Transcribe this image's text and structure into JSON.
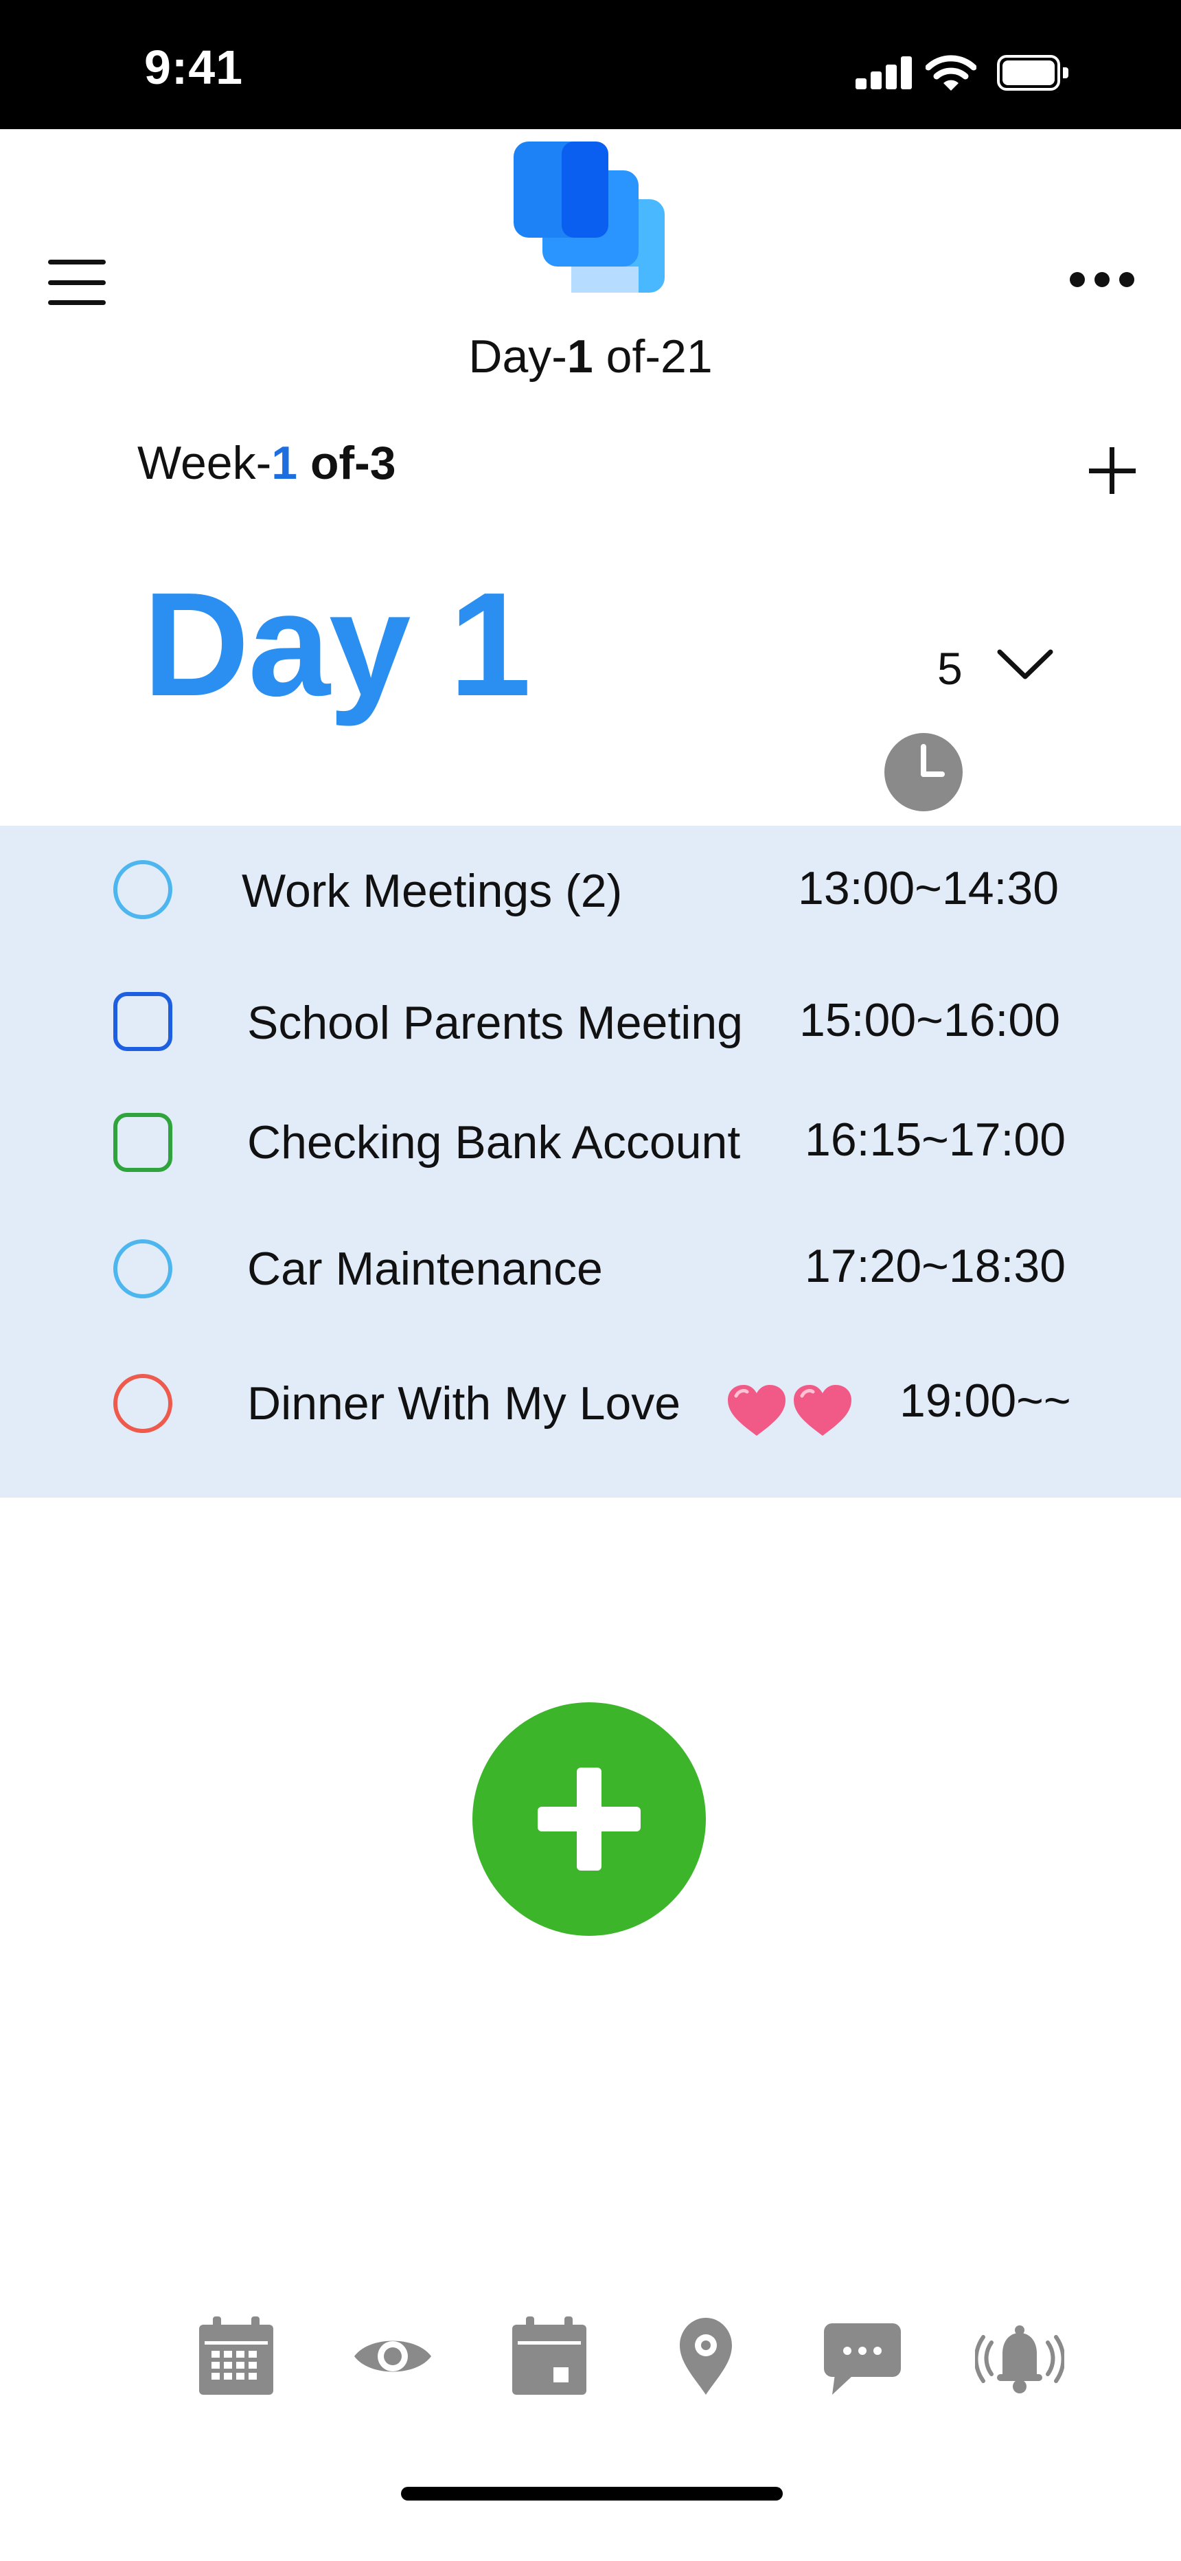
{
  "status_bar": {
    "time": "9:41"
  },
  "header": {
    "day_counter": {
      "prefix": "Day-",
      "current": "1",
      "suffix": " of-21"
    },
    "week_counter": {
      "prefix": "Week-",
      "current": "1",
      "suffix": " of-3"
    }
  },
  "day": {
    "title": "Day 1",
    "count_value": "5"
  },
  "tasks": [
    {
      "name": "Work Meetings (2)",
      "time": "13:00~14:30",
      "marker": "circle",
      "color": "#4db6ee"
    },
    {
      "name": "School Parents Meeting",
      "time": "15:00~16:00",
      "marker": "square",
      "color": "#1d5fe0"
    },
    {
      "name": "Checking Bank Account",
      "time": "16:15~17:00",
      "marker": "square",
      "color": "#2fa33c"
    },
    {
      "name": "Car Maintenance",
      "time": "17:20~18:30",
      "marker": "circle",
      "color": "#4db6ee"
    },
    {
      "name": "Dinner With My Love",
      "time": "19:00~~",
      "marker": "circle",
      "color": "#ee5a4c"
    }
  ],
  "colors": {
    "accent_blue": "#2a8ff0",
    "panel_bg": "#e2ecf9",
    "fab_green": "#3cb52a",
    "icon_gray": "#8a8a8a"
  },
  "bottom_nav": [
    "calendar-grid-icon",
    "eye-icon",
    "calendar-day-icon",
    "location-pin-icon",
    "chat-bubble-icon",
    "bell-ringing-icon"
  ]
}
